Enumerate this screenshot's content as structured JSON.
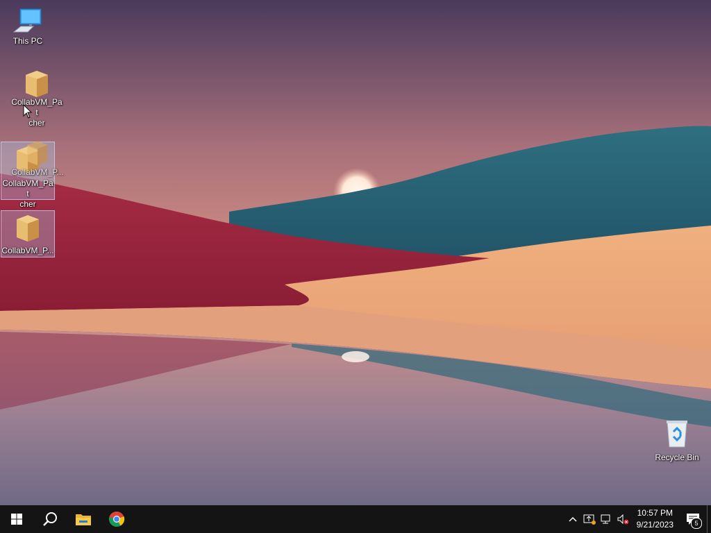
{
  "desktop": {
    "icons": [
      {
        "label": "This PC",
        "icon": "this-pc-icon"
      },
      {
        "label": "CollabVM_Pat\ncher",
        "icon": "package-icon"
      },
      {
        "label": "CollabVM_Pat\ncher",
        "icon": "package-icon",
        "selected": true
      },
      {
        "label": "CollabVM_P...",
        "icon": "package-icon",
        "selected": true
      },
      {
        "label": "Recycle Bin",
        "icon": "recycle-bin-icon"
      }
    ],
    "drag_ghost_label": "CollabVM_P..."
  },
  "taskbar": {
    "start": "start-icon",
    "search": "search-icon",
    "pinned": [
      "file-explorer-icon",
      "chrome-icon"
    ],
    "tray": {
      "icons": [
        "chevron-up-icon",
        "security-icon",
        "network-icon",
        "volume-muted-icon"
      ],
      "time": "10:57 PM",
      "date": "9/21/2023",
      "notification_count": "5"
    }
  },
  "colors": {
    "taskbar": "#141414",
    "sky_top": "#4e3c5e",
    "sky_bottom": "#e19a86",
    "red_dune": "#a8283f",
    "teal_hills": "#2e6478",
    "sand": "#e8a474",
    "water": "#8a7d94"
  }
}
